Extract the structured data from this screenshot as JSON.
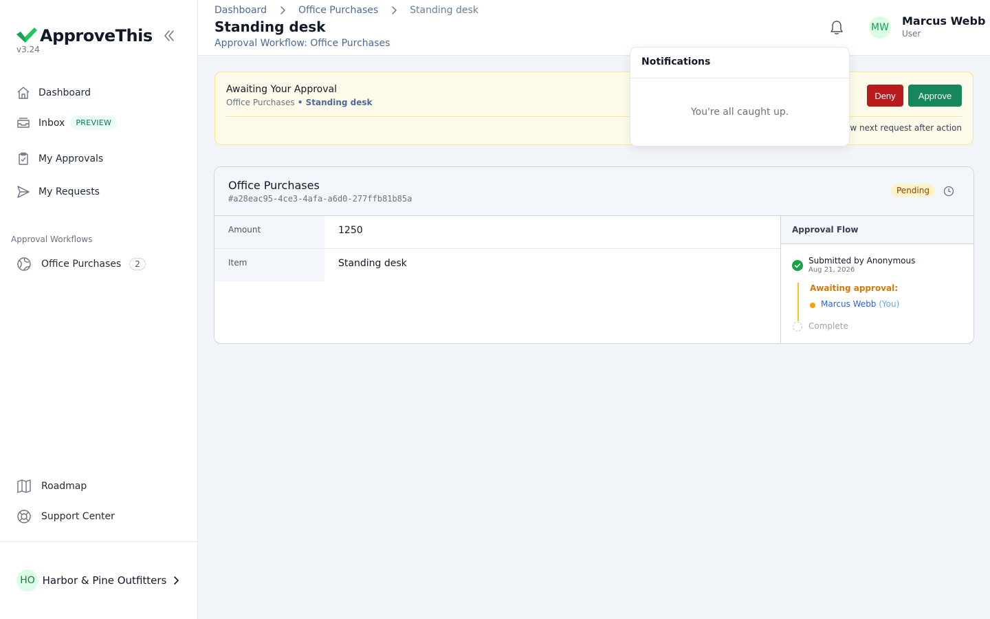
{
  "app": {
    "name": "ApproveThis",
    "version": "v3.24"
  },
  "sidebar": {
    "items": [
      {
        "label": "Dashboard",
        "icon": "home-icon"
      },
      {
        "label": "Inbox",
        "icon": "inbox-icon",
        "badge": "PREVIEW"
      },
      {
        "label": "My Approvals",
        "icon": "clipboard-check-icon"
      },
      {
        "label": "My Requests",
        "icon": "send-icon"
      }
    ],
    "workflows_label": "Approval Workflows",
    "workflows": [
      {
        "label": "Office Purchases",
        "count": "2",
        "icon": "globe-icon"
      }
    ],
    "footer_items": [
      {
        "label": "Roadmap",
        "icon": "map-icon"
      },
      {
        "label": "Support Center",
        "icon": "lifebuoy-icon"
      }
    ],
    "org": {
      "initials": "HO",
      "name": "Harbor & Pine Outfitters"
    }
  },
  "header": {
    "breadcrumb": [
      "Dashboard",
      "Office Purchases",
      "Standing desk"
    ],
    "title": "Standing desk",
    "subtitle": "Approval Workflow: Office Purchases",
    "user": {
      "initials": "MW",
      "name": "Marcus Webb",
      "role": "User"
    }
  },
  "notifications": {
    "title": "Notifications",
    "empty": "You're all caught up."
  },
  "banner": {
    "title": "Awaiting Your Approval",
    "sub_workflow": "Office Purchases",
    "sub_separator": " • ",
    "sub_item": "Standing desk",
    "deny_label": "Deny",
    "approve_label": "Approve",
    "auto_next": "y view next request after action"
  },
  "request": {
    "workflow": "Office Purchases",
    "id": "#a28eac95-4ce3-4afa-a6d0-277ffb81b85a",
    "status": "Pending",
    "fields": [
      {
        "label": "Amount",
        "value": "1250"
      },
      {
        "label": "Item",
        "value": "Standing desk"
      }
    ],
    "flow": {
      "title": "Approval Flow",
      "submitted": "Submitted by Anonymous",
      "date": "Aug 21, 2026",
      "awaiting_label": "Awaiting approval:",
      "approver": "Marcus Webb",
      "approver_you": " (You)",
      "complete": "Complete"
    }
  },
  "colors": {
    "brand": "#16a34a",
    "deny": "#b91c1c",
    "approve": "#15875a",
    "pending": "#fef3c7",
    "banner": "#fffbeb"
  }
}
